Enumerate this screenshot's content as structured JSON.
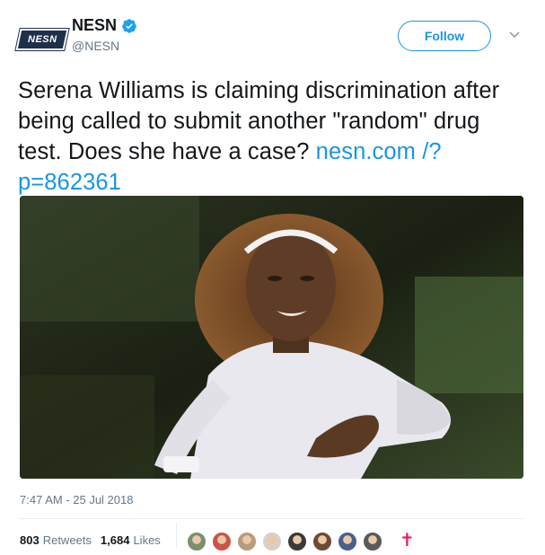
{
  "account": {
    "logo_text": "NESN",
    "display_name": "NESN",
    "handle": "@NESN"
  },
  "header": {
    "follow_label": "Follow"
  },
  "tweet": {
    "text": "Serena Williams is claiming discrimination after being called to submit another \"random\" drug test. Does she have a case? ",
    "link": "nesn.com /?p=862361",
    "timestamp": "7:47 AM - 25 Jul 2018"
  },
  "stats": {
    "retweets_count": "803",
    "retweets_label": "Retweets",
    "likes_count": "1,684",
    "likes_label": "Likes"
  },
  "colors": {
    "accent": "#1b95e0",
    "text": "#14171a",
    "muted": "#657786",
    "logo_bg": "#1f2f4a"
  },
  "liker_avatars": [
    {
      "color": "#7a8f6e"
    },
    {
      "color": "#c9554a"
    },
    {
      "color": "#b89a7d"
    },
    {
      "color": "#d9cfc7"
    },
    {
      "color": "#3a3a3a"
    },
    {
      "color": "#6b4a36"
    },
    {
      "color": "#4a5f8a"
    },
    {
      "color": "#5a5a5a"
    }
  ]
}
